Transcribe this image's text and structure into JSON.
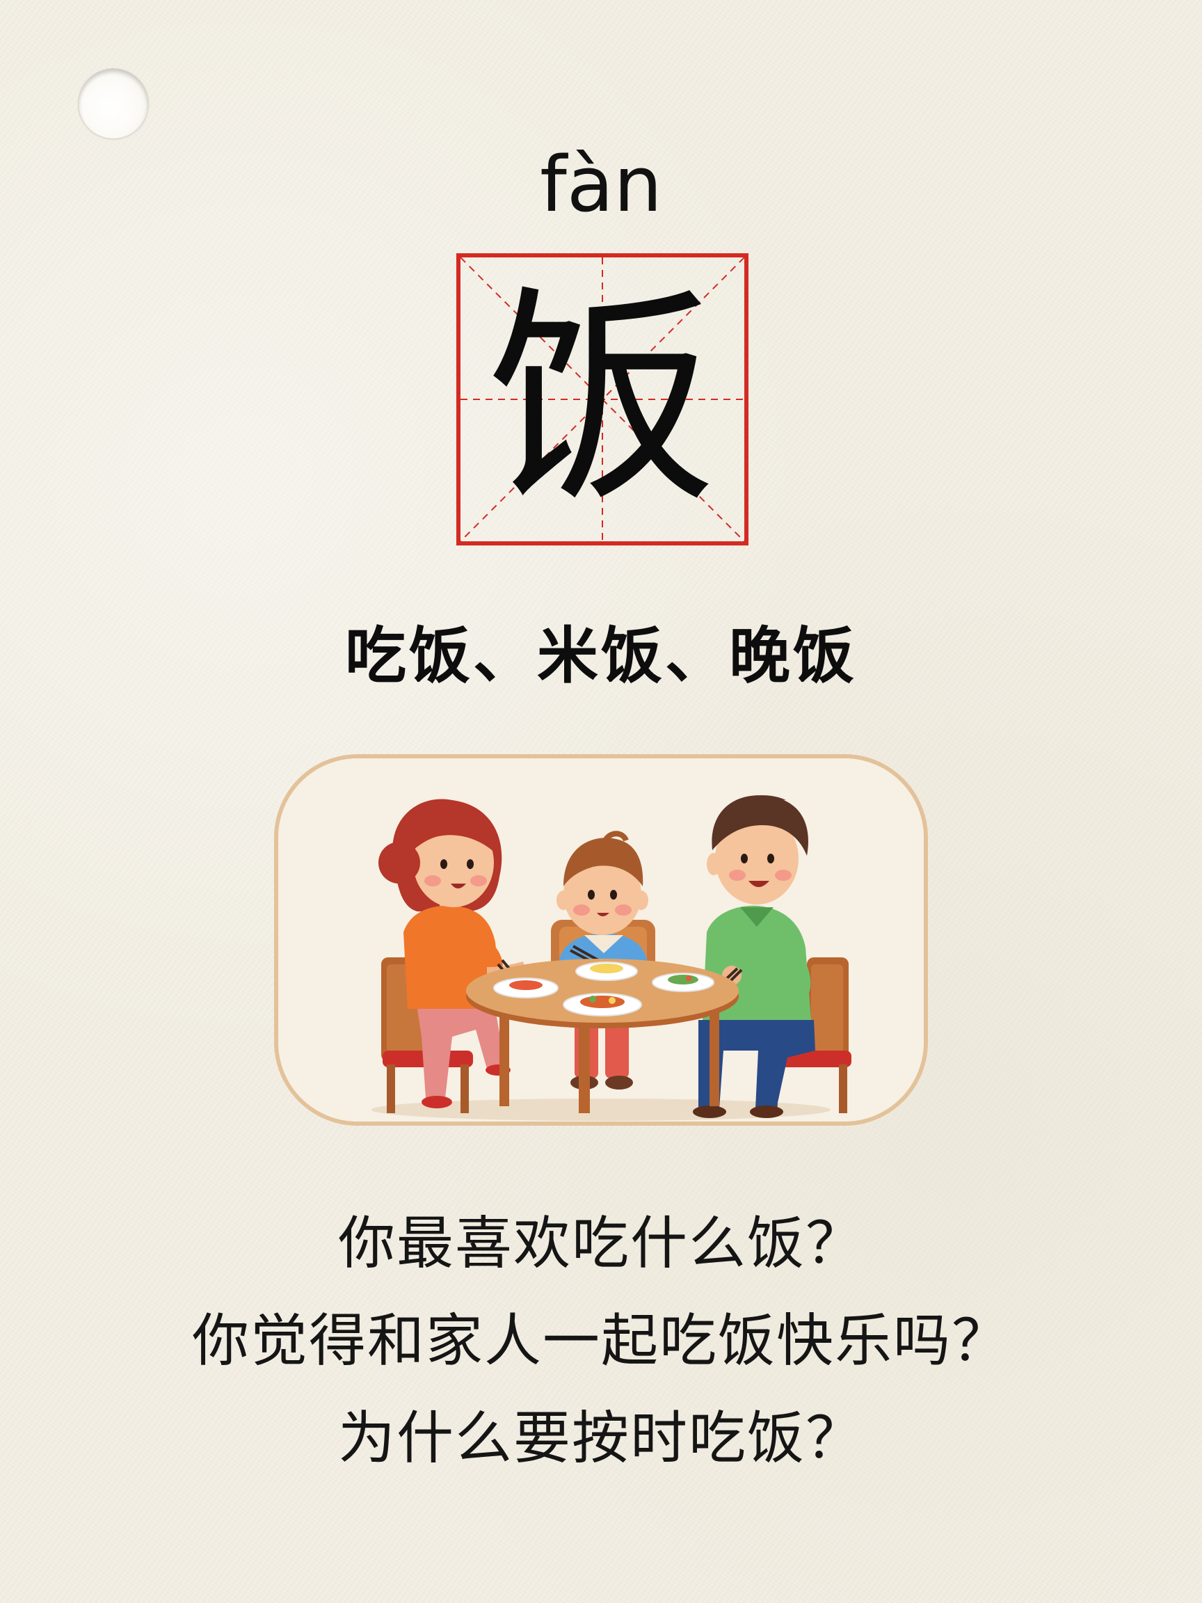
{
  "card": {
    "pinyin": "fàn",
    "character": "饭",
    "words": "吃饭、米饭、晚饭",
    "picture": {
      "icon": "family-eating-dinner-illustration"
    },
    "questions": [
      "你最喜欢吃什么饭？",
      "你觉得和家人一起吃饭快乐吗？",
      "为什么要按时吃饭？"
    ]
  },
  "colors": {
    "background": "#f3efe4",
    "grid_red": "#d42a22",
    "frame_border": "#e3c29a",
    "text": "#111111"
  }
}
